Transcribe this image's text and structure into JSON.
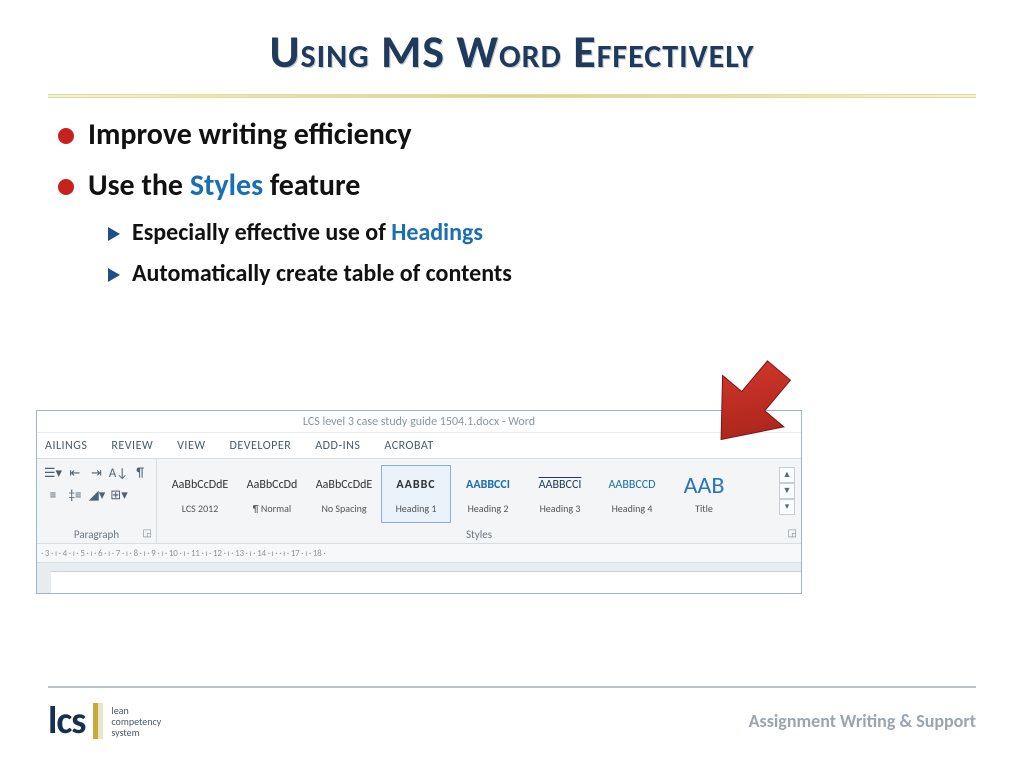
{
  "title": "Using MS Word Effectively",
  "bullets": {
    "b1a": "Improve writing efficiency",
    "b1b_pre": "Use the ",
    "b1b_hl": "Styles",
    "b1b_post": " feature",
    "b2a_pre": "Especially effective use of ",
    "b2a_hl": "Headings",
    "b2b": "Automatically create table of contents"
  },
  "word": {
    "doc_title": "LCS level 3 case study guide 1504.1.docx - Word",
    "tabs": [
      "AILINGS",
      "REVIEW",
      "VIEW",
      "DEVELOPER",
      "ADD-INS",
      "ACROBAT"
    ],
    "paragraph_label": "Paragraph",
    "styles_label": "Styles",
    "styles": [
      {
        "preview": "AaBbCcDdE",
        "name": "LCS 2012",
        "cls": "sp-lcs"
      },
      {
        "preview": "AaBbCcDd",
        "name": "¶ Normal",
        "cls": "sp-lcs"
      },
      {
        "preview": "AaBbCcDdE",
        "name": "No Spacing",
        "cls": "sp-nosp"
      },
      {
        "preview": "AABBC",
        "name": "Heading 1",
        "cls": "sp-h1",
        "selected": true
      },
      {
        "preview": "AABBCCI",
        "name": "Heading 2",
        "cls": "sp-h2"
      },
      {
        "preview": "AABBCCI",
        "name": "Heading 3",
        "cls": "sp-h3"
      },
      {
        "preview": "AABBCCD",
        "name": "Heading 4",
        "cls": "sp-h4"
      },
      {
        "preview": "AAB",
        "name": "Title",
        "cls": "sp-title"
      }
    ],
    "ruler": "· 3 · ı · 4 · ı · 5 · ı · 6 · ı · 7 · ı · 8 · ı · 9 · ı · 10 · ı · 11 · ı · 12 · ı · 13 · ı · 14 · ı ·   · ı   · 17 · ı · 18 ·"
  },
  "footer": {
    "logo_text_1": "lean",
    "logo_text_2": "competency",
    "logo_text_3": "system",
    "right": "Assignment Writing & Support"
  }
}
